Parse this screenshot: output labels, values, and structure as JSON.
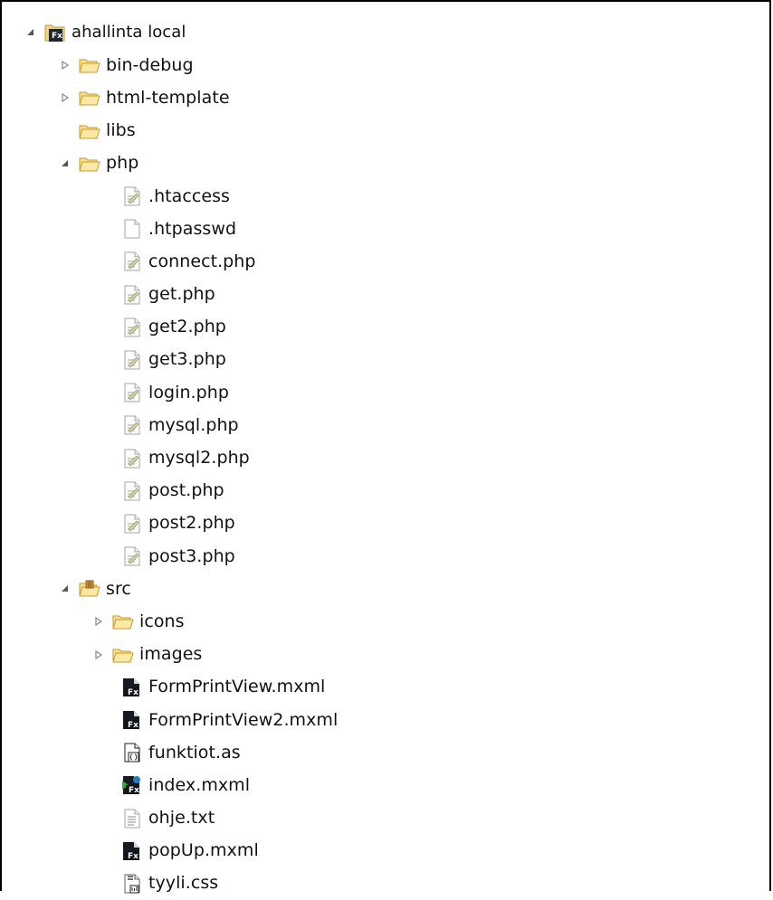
{
  "tree": {
    "root": {
      "label": "ahallinta local",
      "icon": "flex-project-icon"
    },
    "items": [
      {
        "label": "bin-debug",
        "icon": "folder-icon",
        "expanded": false
      },
      {
        "label": "html-template",
        "icon": "folder-icon",
        "expanded": false
      },
      {
        "label": "libs",
        "icon": "folder-icon",
        "expanded": null
      },
      {
        "label": "php",
        "icon": "folder-icon",
        "expanded": true
      },
      {
        "label": ".htaccess",
        "icon": "text-file-icon"
      },
      {
        "label": ".htpasswd",
        "icon": "blank-file-icon"
      },
      {
        "label": "connect.php",
        "icon": "text-file-icon"
      },
      {
        "label": "get.php",
        "icon": "text-file-icon"
      },
      {
        "label": "get2.php",
        "icon": "text-file-icon"
      },
      {
        "label": "get3.php",
        "icon": "text-file-icon"
      },
      {
        "label": "login.php",
        "icon": "text-file-icon"
      },
      {
        "label": "mysql.php",
        "icon": "text-file-icon"
      },
      {
        "label": "mysql2.php",
        "icon": "text-file-icon"
      },
      {
        "label": "post.php",
        "icon": "text-file-icon"
      },
      {
        "label": "post2.php",
        "icon": "text-file-icon"
      },
      {
        "label": "post3.php",
        "icon": "text-file-icon"
      },
      {
        "label": "src",
        "icon": "source-folder-icon",
        "expanded": true
      },
      {
        "label": "icons",
        "icon": "folder-icon",
        "expanded": false
      },
      {
        "label": "images",
        "icon": "folder-icon",
        "expanded": false
      },
      {
        "label": "FormPrintView.mxml",
        "icon": "flex-mxml-icon"
      },
      {
        "label": "FormPrintView2.mxml",
        "icon": "flex-mxml-icon"
      },
      {
        "label": "funktiot.as",
        "icon": "actionscript-file-icon"
      },
      {
        "label": "index.mxml",
        "icon": "flex-application-icon"
      },
      {
        "label": "ohje.txt",
        "icon": "text-document-icon"
      },
      {
        "label": "popUp.mxml",
        "icon": "flex-mxml-icon"
      },
      {
        "label": "tyyli.css",
        "icon": "css-file-icon"
      }
    ]
  }
}
